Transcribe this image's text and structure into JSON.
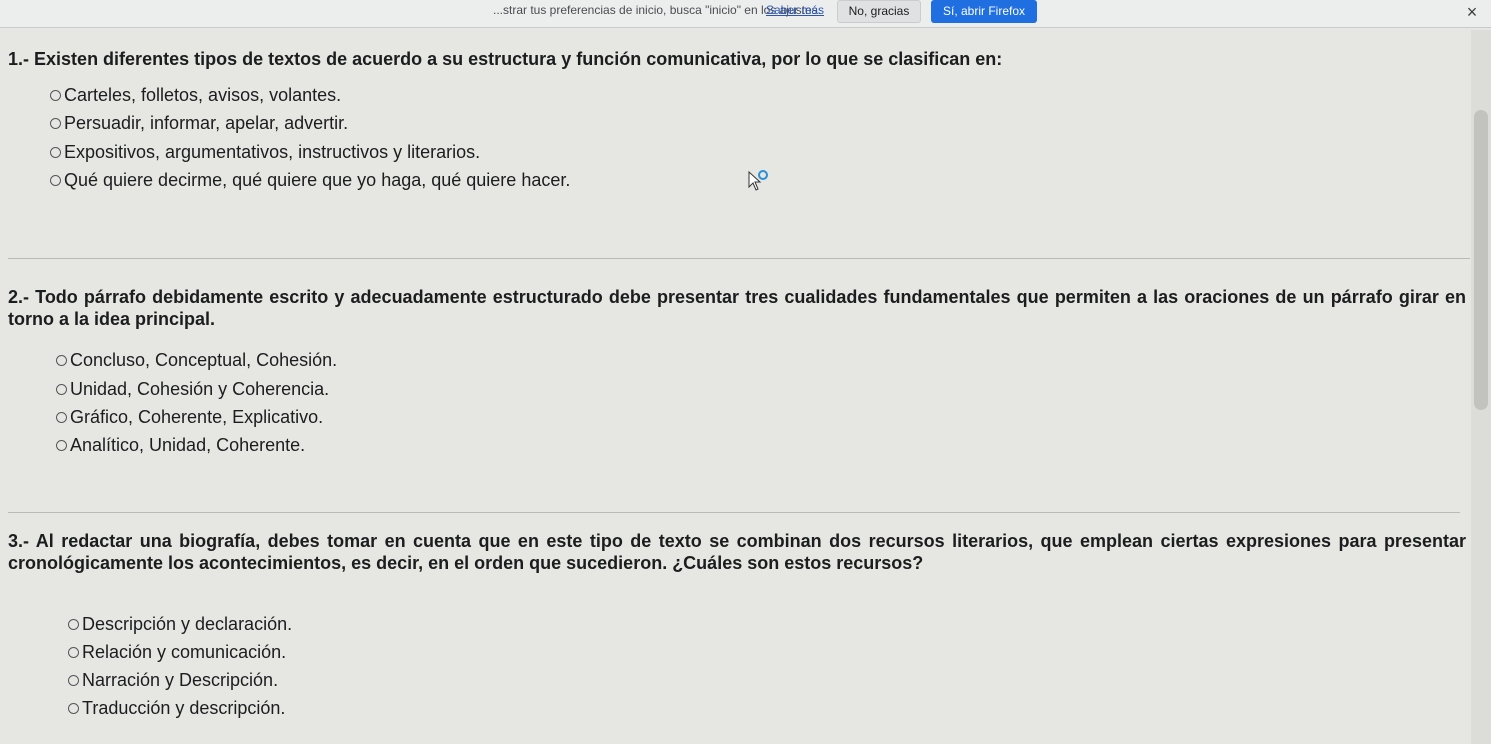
{
  "notification": {
    "text": "...strar tus preferencias de inicio, busca \"inicio\" en los ajustes.",
    "learn_more": "Saber más",
    "no_button": "No, gracias",
    "yes_button": "Sí, abrir Firefox",
    "close": "×"
  },
  "questions": [
    {
      "number": "1.-",
      "text": "Existen diferentes tipos de textos de acuerdo a su estructura y función comunicativa, por lo que se clasifican en:",
      "options": [
        "Carteles, folletos, avisos, volantes.",
        "Persuadir, informar, apelar, advertir.",
        "Expositivos, argumentativos, instructivos y literarios.",
        "Qué quiere decirme, qué quiere que yo haga, qué quiere hacer."
      ]
    },
    {
      "number": "2.-",
      "text": "Todo párrafo debidamente escrito y adecuadamente estructurado debe presentar tres cualidades fundamentales que permiten a las oraciones de un párrafo girar en torno a la idea principal.",
      "options": [
        "Concluso, Conceptual, Cohesión.",
        "Unidad, Cohesión y Coherencia.",
        "Gráfico, Coherente, Explicativo.",
        "Analítico, Unidad, Coherente."
      ]
    },
    {
      "number": "3.-",
      "text": "Al redactar una biografía, debes tomar en cuenta que en este tipo de texto se combinan dos recursos literarios, que emplean ciertas expresiones para presentar cronológicamente los acontecimientos, es decir, en el orden que sucedieron. ¿Cuáles son estos recursos?",
      "options": [
        "Descripción y declaración.",
        "Relación y comunicación.",
        "Narración y Descripción.",
        "Traducción y descripción."
      ]
    }
  ]
}
